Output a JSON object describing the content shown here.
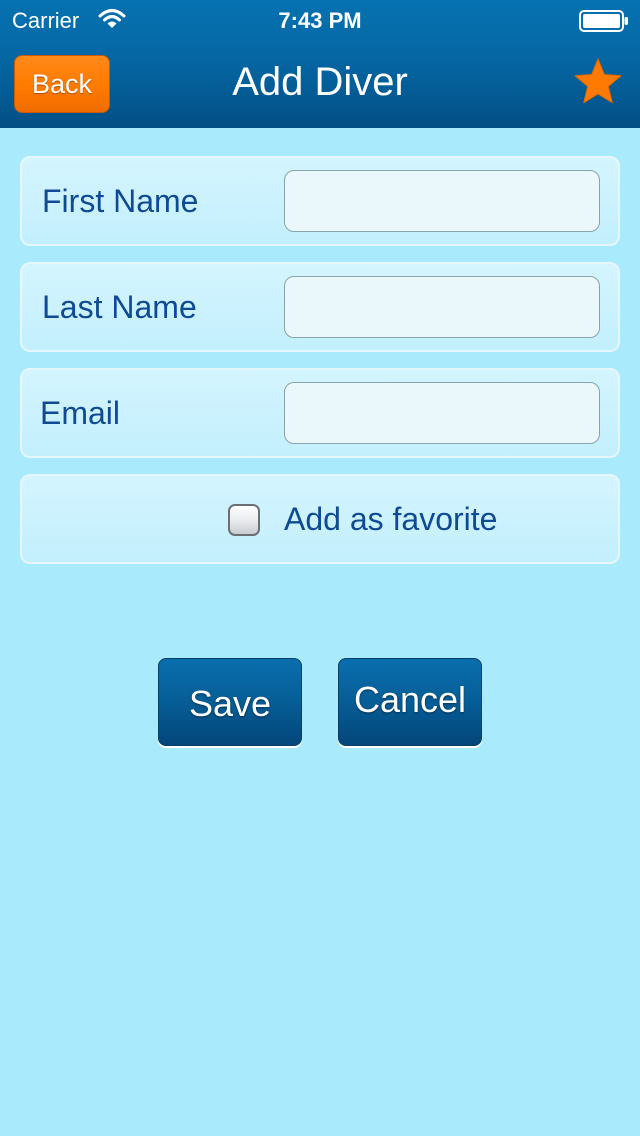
{
  "status_bar": {
    "carrier": "Carrier",
    "time": "7:43 PM",
    "wifi_icon": "wifi-icon",
    "battery_icon": "battery-icon"
  },
  "nav_bar": {
    "back_label": "Back",
    "title": "Add Diver",
    "favorite_icon": "star-icon"
  },
  "form": {
    "first_name": {
      "label": "First Name",
      "value": "",
      "placeholder": ""
    },
    "last_name": {
      "label": "Last Name",
      "value": "",
      "placeholder": ""
    },
    "email": {
      "label": "Email",
      "value": "",
      "placeholder": ""
    },
    "favorite": {
      "label": "Add as favorite",
      "checked": false
    }
  },
  "actions": {
    "save_label": "Save",
    "cancel_label": "Cancel"
  },
  "colors": {
    "background": "#aaeafd",
    "nav_bar": "#0567a4",
    "back_button": "#ff7a00",
    "star": "#ff7a00",
    "label_text": "#0f4a95",
    "action_button": "#065d96"
  }
}
